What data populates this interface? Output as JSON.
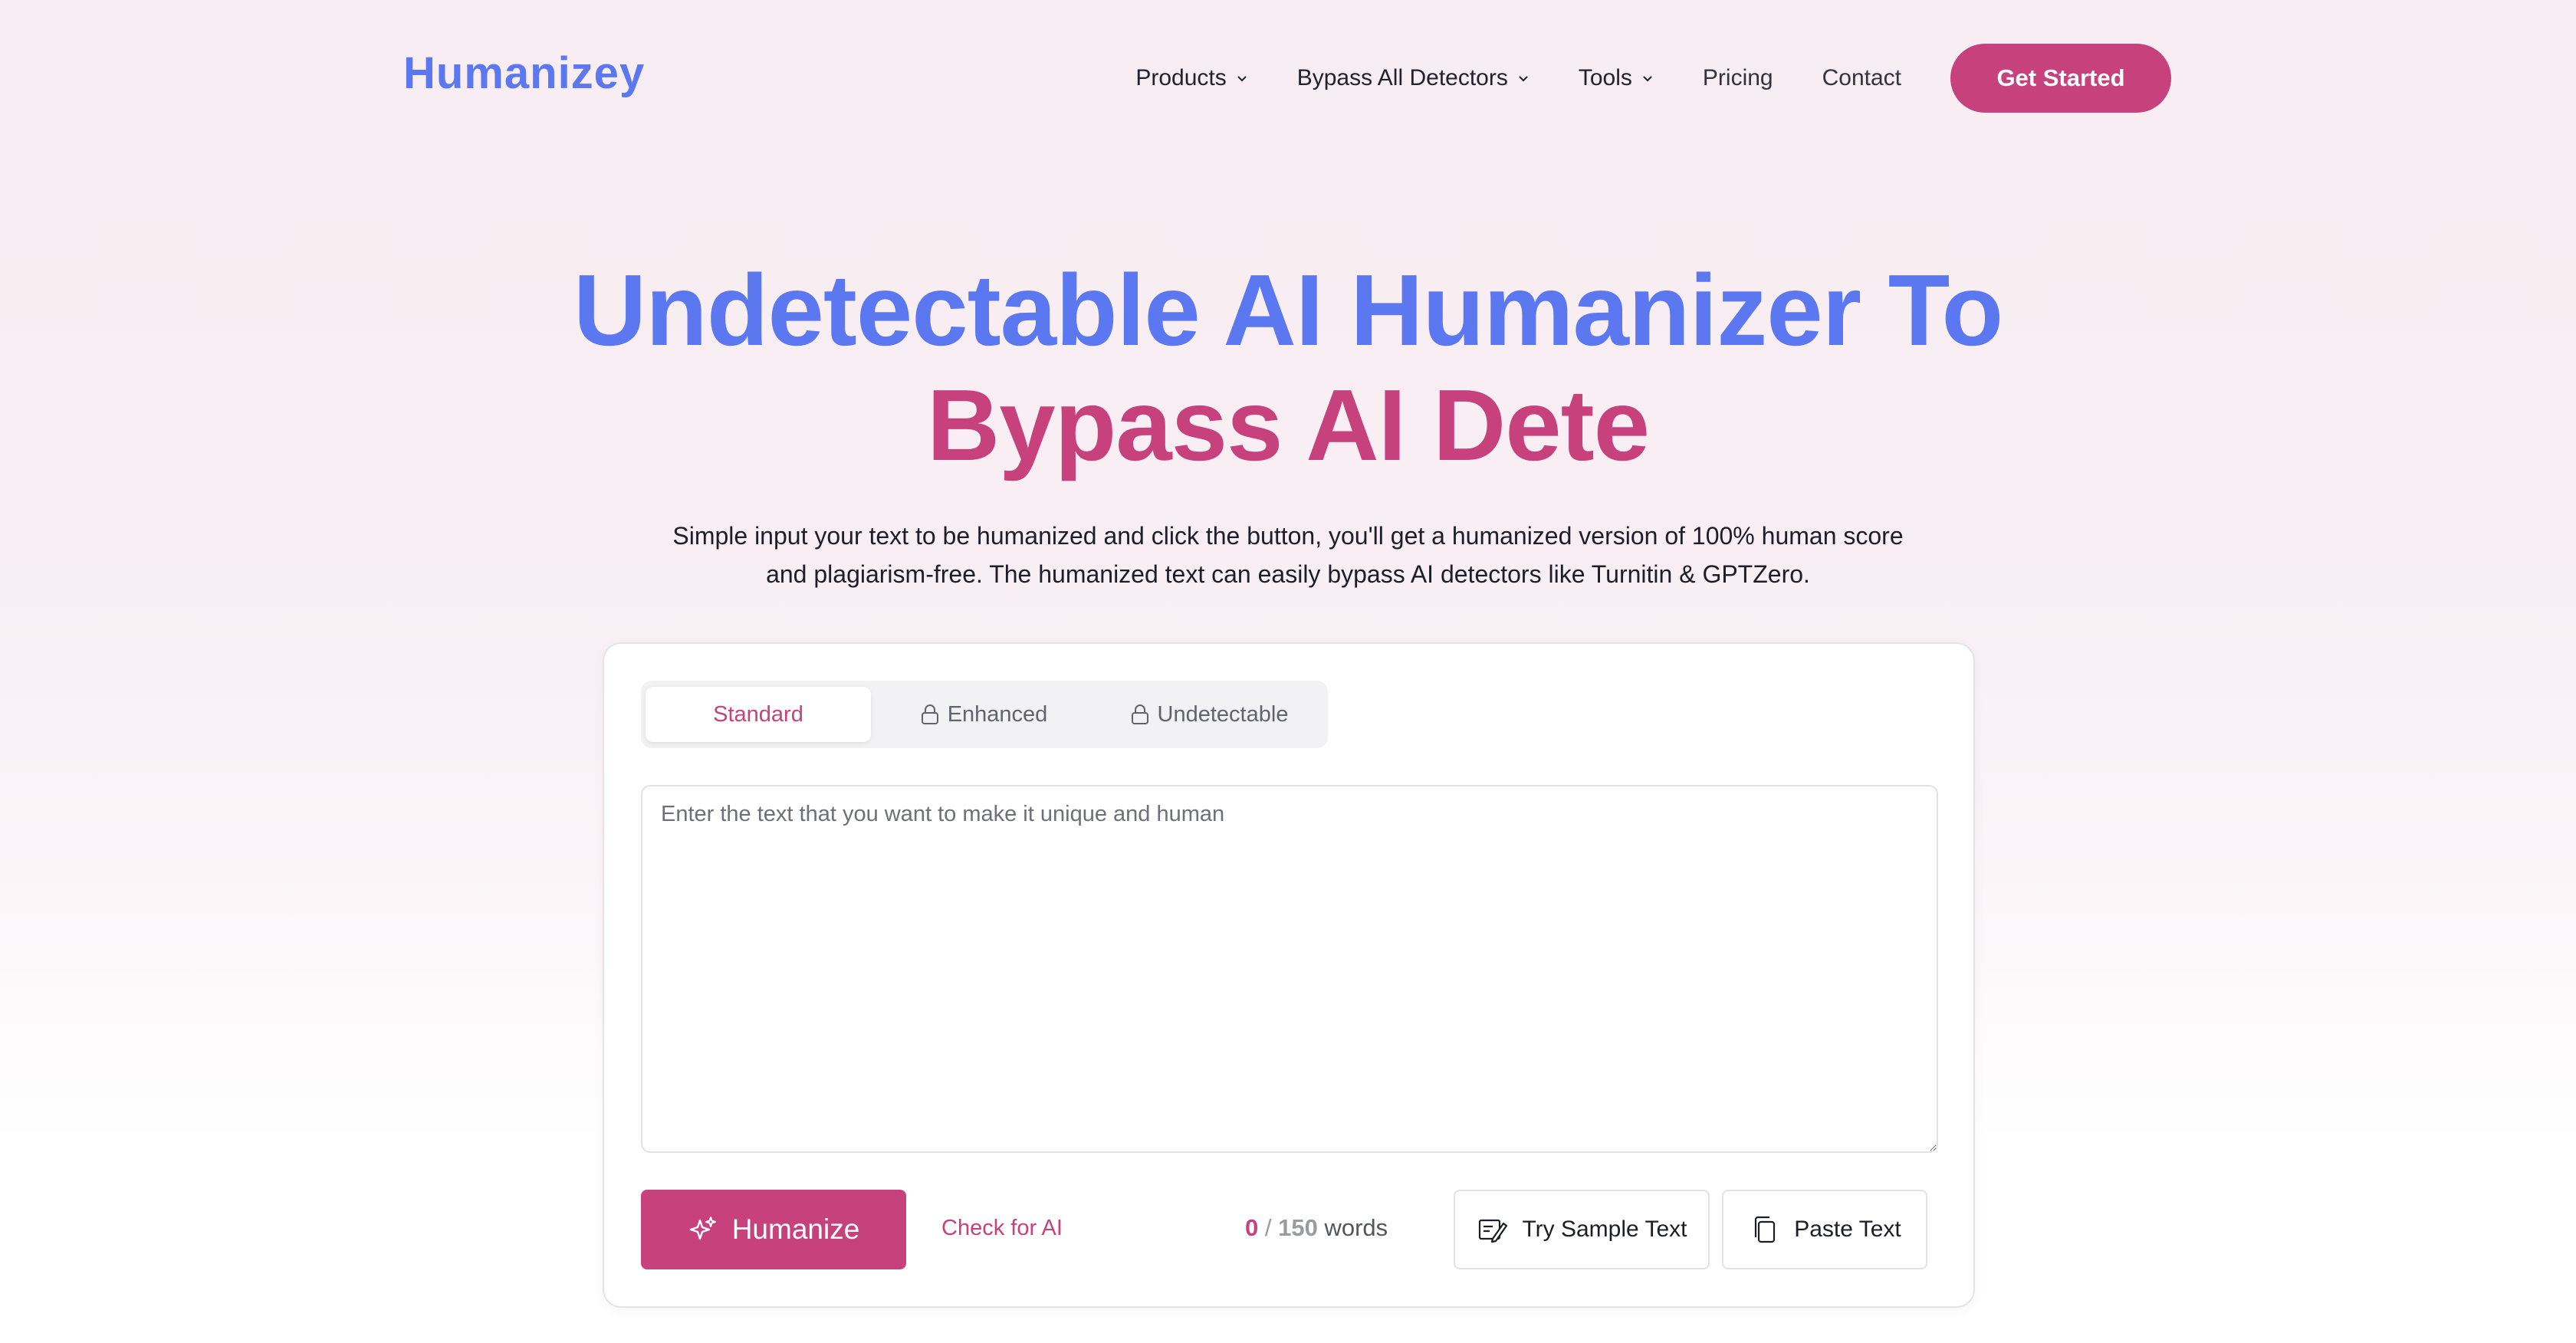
{
  "brand": {
    "logo": "Humanizey",
    "accent": "#5b78f0",
    "primary": "#c7417c"
  },
  "nav": {
    "items": [
      {
        "label": "Products",
        "dropdown": true
      },
      {
        "label": "Bypass All Detectors",
        "dropdown": true
      },
      {
        "label": "Tools",
        "dropdown": true
      },
      {
        "label": "Pricing",
        "dropdown": false
      },
      {
        "label": "Contact",
        "dropdown": false
      }
    ],
    "cta": "Get Started"
  },
  "hero": {
    "title_line1": "Undetectable AI Humanizer To",
    "title_line2": "Bypass AI Dete",
    "subtitle": "Simple input your text to be humanized and click the button, you'll get a humanized version of 100% human score and plagiarism-free. The humanized text can easily bypass AI detectors like Turnitin & GPTZero."
  },
  "editor": {
    "modes": [
      {
        "label": "Standard",
        "locked": false,
        "active": true
      },
      {
        "label": "Enhanced",
        "locked": true,
        "active": false
      },
      {
        "label": "Undetectable",
        "locked": true,
        "active": false
      }
    ],
    "placeholder": "Enter the text that you want to make it unique and human",
    "value": "",
    "humanize_label": "Humanize",
    "check_ai_label": "Check for AI",
    "word_count": {
      "current": "0",
      "separator": "/",
      "max": "150",
      "unit": "words"
    },
    "sample_label": "Try Sample Text",
    "paste_label": "Paste Text"
  }
}
